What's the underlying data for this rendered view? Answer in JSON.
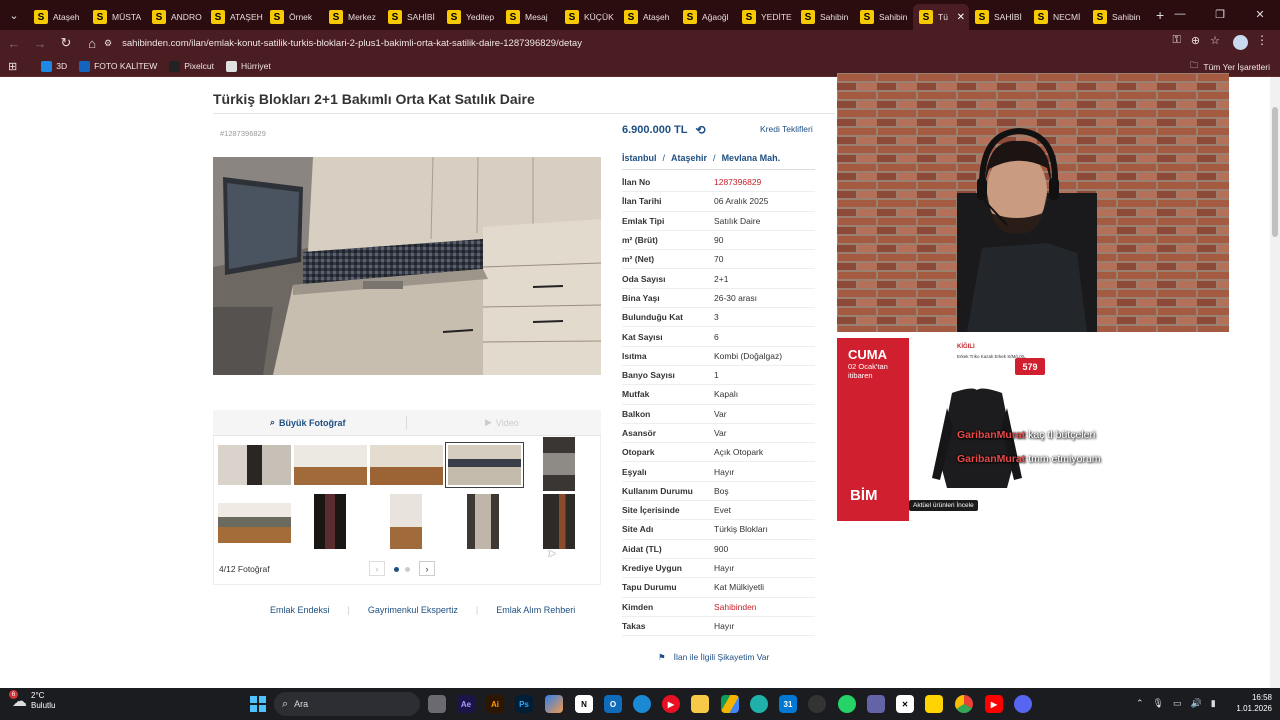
{
  "browser": {
    "tabs": [
      {
        "label": "Ataşeh"
      },
      {
        "label": "MÜSTA"
      },
      {
        "label": "ANDRO"
      },
      {
        "label": "ATAŞEH"
      },
      {
        "label": "Örnek"
      },
      {
        "label": "Merkez"
      },
      {
        "label": "SAHİBİ"
      },
      {
        "label": "Yeditep"
      },
      {
        "label": "Mesaj"
      },
      {
        "label": "KÜÇÜK"
      },
      {
        "label": "Ataşeh"
      },
      {
        "label": "Ağaoğl"
      },
      {
        "label": "YEDİTE"
      },
      {
        "label": "Sahibin"
      },
      {
        "label": "Sahibin"
      },
      {
        "label": "Tü"
      },
      {
        "label": "SAHİBİ"
      },
      {
        "label": "NECMİ"
      },
      {
        "label": "Sahibin"
      }
    ],
    "active_tab_index": 15,
    "url": "sahibinden.com/ilan/emlak-konut-satilik-turkis-bloklari-2-plus1-bakimli-orta-kat-satilik-daire-1287396829/detay",
    "bookmarks": [
      {
        "label": "3D",
        "color": "#1e88e5"
      },
      {
        "label": "FOTO KALİTEW",
        "color": "#1565c0"
      },
      {
        "label": "Pixelcut",
        "color": "#222"
      },
      {
        "label": "Hürriyet",
        "color": "#e0e0e0"
      }
    ],
    "bookmarks_all": "Tüm Yer İşaretleri"
  },
  "listing": {
    "title": "Türkiş Blokları 2+1 Bakımlı Orta Kat Satılık Daire",
    "id_label": "#1287396829",
    "price": "6.900.000 TL",
    "credit_link": "Kredi Teklifleri",
    "location": [
      "İstanbul",
      "Ataşehir",
      "Mevlana Mah."
    ],
    "photo_tabs": {
      "big": "Büyük Fotoğraf",
      "video": "Video"
    },
    "gallery_count": "4/12 Fotoğraf",
    "attributes": [
      {
        "k": "İlan No",
        "v": "1287396829",
        "red": true
      },
      {
        "k": "İlan Tarihi",
        "v": "06 Aralık 2025"
      },
      {
        "k": "Emlak Tipi",
        "v": "Satılık Daire"
      },
      {
        "k": "m² (Brüt)",
        "v": "90"
      },
      {
        "k": "m² (Net)",
        "v": "70"
      },
      {
        "k": "Oda Sayısı",
        "v": "2+1"
      },
      {
        "k": "Bina Yaşı",
        "v": "26-30 arası"
      },
      {
        "k": "Bulunduğu Kat",
        "v": "3"
      },
      {
        "k": "Kat Sayısı",
        "v": "6"
      },
      {
        "k": "Isıtma",
        "v": "Kombi (Doğalgaz)"
      },
      {
        "k": "Banyo Sayısı",
        "v": "1"
      },
      {
        "k": "Mutfak",
        "v": "Kapalı"
      },
      {
        "k": "Balkon",
        "v": "Var"
      },
      {
        "k": "Asansör",
        "v": "Var"
      },
      {
        "k": "Otopark",
        "v": "Açık Otopark"
      },
      {
        "k": "Eşyalı",
        "v": "Hayır"
      },
      {
        "k": "Kullanım Durumu",
        "v": "Boş"
      },
      {
        "k": "Site İçerisinde",
        "v": "Evet"
      },
      {
        "k": "Site Adı",
        "v": "Türkiş Blokları"
      },
      {
        "k": "Aidat (TL)",
        "v": "900"
      },
      {
        "k": "Krediye Uygun",
        "v": "Hayır"
      },
      {
        "k": "Tapu Durumu",
        "v": "Kat Mülkiyetli"
      },
      {
        "k": "Kimden",
        "v": "Sahibinden",
        "red": true
      },
      {
        "k": "Takas",
        "v": "Hayır"
      }
    ],
    "footer_links": [
      "Emlak Endeksi",
      "Gayrimenkul Ekspertiz",
      "Emlak Alım Rehberi"
    ],
    "complaint": "İlan ile İlgili Şikayetim Var"
  },
  "ad": {
    "day": "CUMA",
    "date": "02 Ocak'tan itibaren",
    "brand": "KİĞILI",
    "product": "Erkek Triko Kazak Erkek S/M/L/XL",
    "price": "579",
    "logo": "BİM",
    "cta": "Aktüel ürünleri İncele"
  },
  "chat": [
    {
      "user": "GaribanMurat",
      "msg": "kaç tl bütçeleri"
    },
    {
      "user": "GaribanMurat",
      "msg": "tmm etmiyorum"
    }
  ],
  "taskbar": {
    "weather_temp": "2°C",
    "weather_desc": "Bulutlu",
    "weather_badge": "6",
    "search_placeholder": "Ara",
    "time": "16:58",
    "date": "1.01.2026"
  }
}
